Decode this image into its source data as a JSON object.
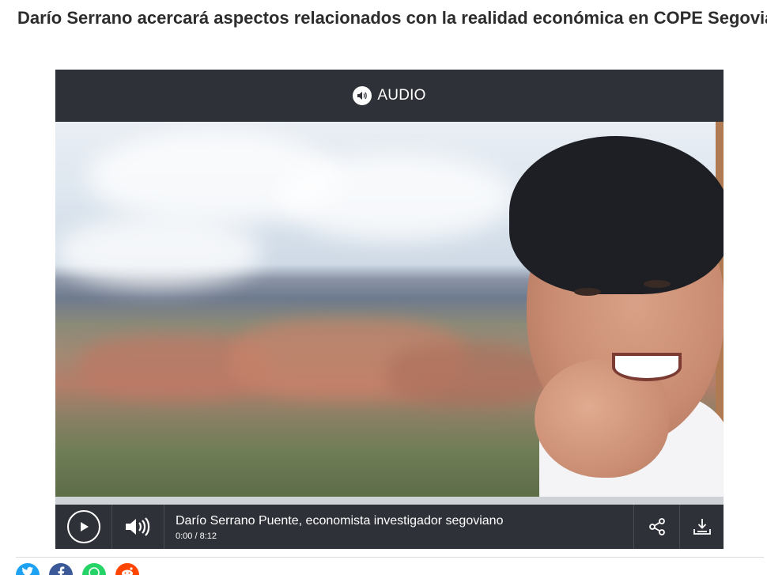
{
  "article": {
    "headline": "Darío Serrano acercará aspectos relacionados con la realidad económica en COPE Segovia"
  },
  "player": {
    "header_label": "AUDIO",
    "header_icon": "speaker-icon",
    "track_title": "Darío Serrano Puente, economista investigador segoviano",
    "time_display": "0:00 / 8:12",
    "progress": 0,
    "controls": {
      "play_icon": "play-icon",
      "volume_icon": "volume-icon",
      "share_icon": "share-icon",
      "download_icon": "download-icon"
    }
  },
  "share_buttons": [
    {
      "name": "twitter",
      "icon": "twitter-icon",
      "color": "#1da1f2"
    },
    {
      "name": "facebook",
      "icon": "facebook-icon",
      "color": "#3b5998"
    },
    {
      "name": "whatsapp",
      "icon": "whatsapp-icon",
      "color": "#25d366"
    },
    {
      "name": "reddit",
      "icon": "reddit-icon",
      "color": "#ff4500"
    }
  ],
  "colors": {
    "player_bg": "#2f3138",
    "track": "#cfd2d6"
  }
}
